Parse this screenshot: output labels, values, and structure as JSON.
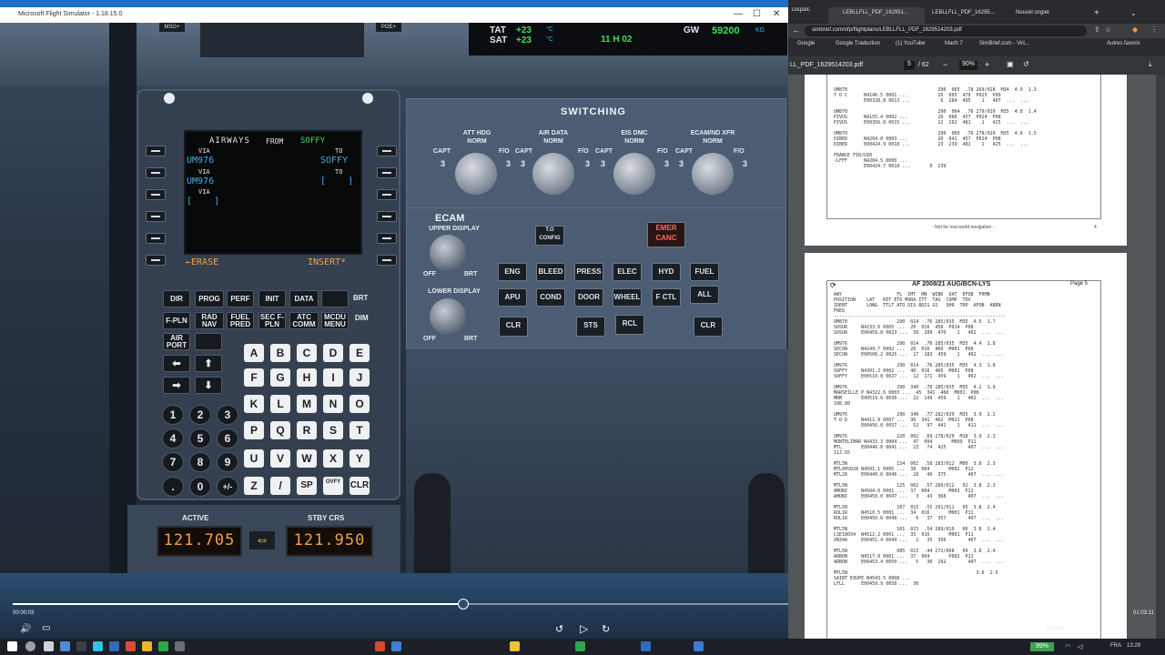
{
  "fs": {
    "title": "Microsoft Flight Simulator - 1.18.15.0",
    "overhead": {
      "tat_label": "TAT",
      "tat_value": "+23",
      "sat_label": "SAT",
      "sat_value": "+23",
      "unit": "°C",
      "clock": "11 H 02",
      "gw_label": "GW",
      "gw_value": "59200",
      "gw_unit": "KG"
    },
    "top_buttons": {
      "msg": "MSG+",
      "poe": "POE+"
    },
    "mcdu": {
      "screen": {
        "title": "AIRWAYS",
        "from_word": "FROM",
        "from_value": "SOFFY",
        "via1_label": "VIA",
        "via1_value": "UM976",
        "to1_label": "TO",
        "to1_value": "SOFFY",
        "via2_label": "VIA",
        "via2_value": "UM976",
        "to2_label": "TO",
        "to2_value": "[    ]",
        "via3_label": "VIA",
        "via3_value": "[    ]",
        "erase": "←ERASE",
        "insert": "INSERT*"
      },
      "func_keys_row1": [
        "DIR",
        "PROG",
        "PERF",
        "INIT",
        "DATA"
      ],
      "func_keys_row2": [
        "F-PLN",
        "RAD NAV",
        "FUEL PRED",
        "SEC F-PLN",
        "ATC COMM",
        "MCDU MENU"
      ],
      "air_port": "AIR PORT",
      "brt": "BRT",
      "dim": "DIM",
      "letters": [
        "A",
        "B",
        "C",
        "D",
        "E",
        "F",
        "G",
        "H",
        "I",
        "J",
        "K",
        "L",
        "M",
        "N",
        "O",
        "P",
        "Q",
        "R",
        "S",
        "T",
        "U",
        "V",
        "W",
        "X",
        "Y",
        "Z",
        "/",
        "SP",
        "OVFY",
        "CLR"
      ],
      "numbers": [
        "1",
        "2",
        "3",
        "4",
        "5",
        "6",
        "7",
        "8",
        "9",
        ".",
        "0",
        "+/-"
      ]
    },
    "switching": {
      "title": "SWITCHING",
      "knobs": [
        {
          "name": "ATT HDG",
          "mode": "NORM",
          "left": "CAPT",
          "right": "F/O",
          "num": "3"
        },
        {
          "name": "AIR DATA",
          "mode": "NORM",
          "left": "CAPT",
          "right": "F/O",
          "num": "3"
        },
        {
          "name": "EIS DMC",
          "mode": "NORM",
          "left": "CAPT",
          "right": "F/O",
          "num": "3"
        },
        {
          "name": "ECAM/ND XFR",
          "mode": "NORM",
          "left": "CAPT",
          "right": "F/O",
          "num": "3"
        }
      ]
    },
    "ecam": {
      "title": "ECAM",
      "upper": "UPPER DISPLAY",
      "lower": "LOWER DISPLAY",
      "off": "OFF",
      "brt": "BRT",
      "to_config": "T.O CONFIG",
      "emer_canc": "EMER CANC",
      "row1": [
        "ENG",
        "BLEED",
        "PRESS",
        "ELEC",
        "HYD",
        "FUEL"
      ],
      "row2": [
        "APU",
        "COND",
        "DOOR",
        "WHEEL",
        "F CTL",
        "ALL"
      ],
      "row3": [
        "CLR",
        "STS",
        "RCL",
        "CLR"
      ]
    },
    "radio": {
      "active_label": "ACTIVE",
      "active_value": "121.705",
      "stby_label": "STBY CRS",
      "stby_value": "121.950"
    }
  },
  "player": {
    "time_elapsed": "00:00:03",
    "time_total": "01:03:11",
    "progress": 0.58
  },
  "chrome": {
    "tabs": [
      "Dispatc",
      "LEBLLFLL_PDF_162951...",
      "LEBLLFLL_PDF_16295...",
      "Nouvel onglet"
    ],
    "url": "simbrief.com/ofp/flightplans/LEBLLFLL_PDF_1629514203.pdf",
    "bookmarks": [
      "Google",
      "Google Traduction",
      "(1) YouTube",
      "Mach 7",
      "SimBrief.com - Virt...",
      "Autres favoris"
    ],
    "pdf": {
      "filename": "LL_PDF_1629514203.pdf",
      "page_current": "5",
      "page_total": "/ 62",
      "zoom": "90%",
      "footer_note": "- Not for real world navigation -",
      "footer_page": "4",
      "page5_header": "AF 2008/21 AUG/BCN-LYS",
      "page5_pageno": "Page 5",
      "page4_text": "UM870                                 290  065  .78 269/028  M34  4.9  1.3\nT O C      N4146.5 0001 ...           20  065  470  P025  P09\n           E00328.8 0013 ...           6  284  495    1   407  ...  ...\n\nUM870                                 290  064  .76 279/029  M35  4.8  1.4\nPIVUS      N4155.4 0002 ...           20  066  457  P024  P08\nPIVUS      E00356.0 0015 ...          22  262  481    1   425  ...  ...\n\nUM870                                 290  060  .76 278/029  M35  4.6  1.5\nDIBER      N4204.8 0003 ...           20  041  457  P024  P08\nDIBER      E00424.9 0018 ...          23  239  481    1   425  ...  ...\n\nFRANCE FIR/UIR\n-LFFF      N4204.5 0000 ...\n           E00424.7 0018 ...       0  239",
      "page5_text": "AWY                    FL  IMT  MN  WIND  OAT  EFOB  FRMN\nPOSITION    LAT   KET ETO MORA ITT  TAS  COMP  TDV\nIDENT       LONG  TTLT ATO DIS RDIS GS   SHR  TRP  AFOB  ABRN\nFREQ\n---------------------------------------------------------------\nUM870                  290  014  .76 285/035  M35  4.5  1.7\nSOSUR     N4233.6 0005 ...  20  016  458  P014  P08\nSOSUR     E00459.8 0023 ...  39  200  470    1   402  ...  ...\n\nUM976                  290  014  .76 285/035  M35  4.4  1.8\nSECON     N4249.7 0002 ...  20  016  460  M001  P08\nSECON     E00506.2 0025 ...  17  183  459    1   402  ...  ...\n\nUM976                  290  014  .76 285/035  M35  4.3  1.8\nSOFFY     N4301.2 0002 ...  40  016  460  M001  P08\nSOFFY     E00510.8 0027 ...  12  171  459    1   402  ...  ...\n\nUM976                  290  340  .76 285/035  M35  4.2  1.9\nMARSEILLE P N4322.6 0003 ...  45  341  460  M001  P08\nMRM       E00519.6 0030 ...  22  149  459    1   402  ...  ...\n108.80\n\nUM976                  290  340  .77 282/039  M35  3.9  2.2\nT O D     N4411.9 0007 ...  36  341  462  M021  P08\n          E00456.8 0037 ...  52   97  441    1   411  ...  ...\n\nUM976                  220  002  .69 278/020  M18  3.9  2.3\nMONTELIMAR N4433.3 0004 ...  47  004       M009  P11\nMTL       E00446.8 0041 ...  23   74  425        407  ...  ...\n113.65\n\nMTL5N                  134  002  .58 283/012  M00  3.8  2.3\nMTL005028 N4501.1 0005 ...  38  004       M002  P12\nMTL28     E00449.6 0046 ...  28   46  375        407  ...  ...\n\nMTL5N                  125  002  .57 289/012   02  3.8  2.3\nAMONI     N4504.0 0001 ...  37  004       M003  P12\nAMONI     E00450.0 0047 ...   3   43  368        407  ...  ...\n\nMTL5N                  107  015  .55 291/011   05  3.8  2.4\nROL1R     N4510.5 0001 ...  34  016       M001  P11\nROL1R     E00450.6 0048 ...   6   37  357        407  ...  ...\n\nMTL5N                  101  015  .54 289/010   06  3.8  2.4\nLSE18034  N4512.2 0001 ...  35  016       M001  P11\nVN34A     E00451.4 0049 ...   2   35  356        407  ...  ...\n\nMTL5N                  085  015  .44 272/008   09  3.8  2.4\nARBON     N4517.0 0001 ...  37  004       P002  P11\nARBON     E00453.4 0050 ...   5   30  292        407  ...  ...\n\nMTL5N                                               3.6  2.5\nSAINT EXUPE N4543.5 0008 ...\nLFLL      E00459.9 0058 ...  30"
    }
  },
  "taskbar": {
    "battery": "99%",
    "bureau": "Bureau",
    "lang": "FRA",
    "time": "13:29"
  }
}
